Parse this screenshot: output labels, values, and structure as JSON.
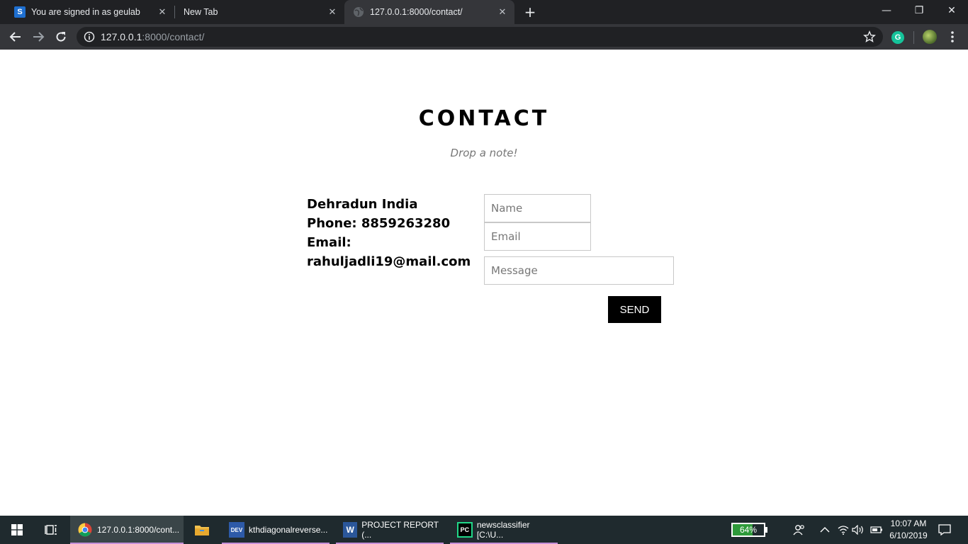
{
  "browser": {
    "tabs": [
      {
        "title": "You are signed in as geulab",
        "favicon": "s-icon"
      },
      {
        "title": "New Tab"
      },
      {
        "title": "127.0.0.1:8000/contact/",
        "favicon": "globe-icon",
        "active": true
      }
    ],
    "close_glyph": "✕",
    "new_tab_glyph": "+",
    "window_controls": {
      "minimize": "—",
      "maximize": "❐",
      "close": "✕"
    },
    "address": {
      "host": "127.0.0.1",
      "path": ":8000/contact/"
    },
    "extension_letter": "G"
  },
  "page": {
    "title": "CONTACT",
    "subtitle": "Drop a note!",
    "info_lines": [
      "Dehradun India",
      "Phone: 8859263280",
      "Email:",
      "rahuljadli19@mail.com"
    ],
    "form": {
      "name_placeholder": "Name",
      "email_placeholder": "Email",
      "message_placeholder": "Message",
      "send_label": "SEND"
    }
  },
  "taskbar": {
    "apps": [
      {
        "label": "127.0.0.1:8000/cont...",
        "icon": "chrome-icon",
        "active": true
      },
      {
        "label": "",
        "icon": "file-explorer-icon"
      },
      {
        "label": "kthdiagonalreverse...",
        "icon": "devcpp-icon",
        "icon_text": "DEV"
      },
      {
        "label": "PROJECT REPORT (...",
        "icon": "word-icon",
        "icon_text": "W"
      },
      {
        "label": "newsclassifier [C:\\U...",
        "icon": "pycharm-icon",
        "icon_text": "PC"
      }
    ],
    "battery": {
      "label": "64%",
      "level": 0.64
    },
    "time": "10:07 AM",
    "date": "6/10/2019"
  }
}
